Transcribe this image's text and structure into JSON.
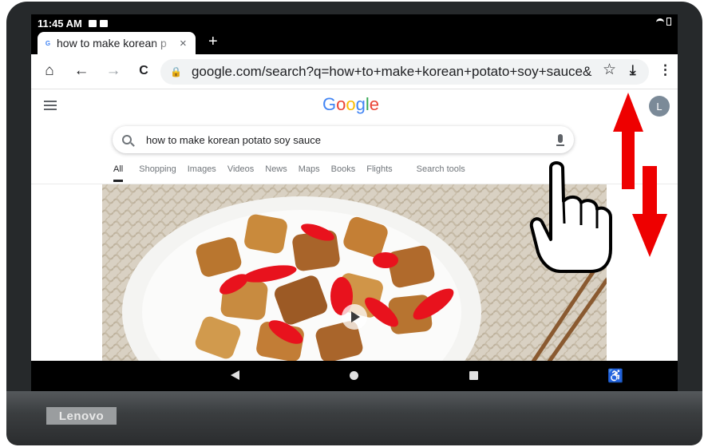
{
  "device": {
    "brand": "Lenovo"
  },
  "status_bar": {
    "time": "11:45 AM"
  },
  "tab": {
    "title": "how to make korean p",
    "close": "×",
    "new_tab": "+"
  },
  "toolbar": {
    "home": "⌂",
    "back": "←",
    "forward": "→",
    "reload": "C",
    "url": "google.com/search?q=how+to+make+korean+potato+soy+sauce&",
    "star": "☆",
    "download": "⤓",
    "menu": "⋮"
  },
  "google": {
    "logo_letters": [
      {
        "ch": "G",
        "color": "#4285F4"
      },
      {
        "ch": "o",
        "color": "#EA4335"
      },
      {
        "ch": "o",
        "color": "#FBBC05"
      },
      {
        "ch": "g",
        "color": "#4285F4"
      },
      {
        "ch": "l",
        "color": "#34A853"
      },
      {
        "ch": "e",
        "color": "#EA4335"
      }
    ],
    "avatar_letter": "L",
    "query": "how to make korean potato soy sauce",
    "nav_tabs": [
      "All",
      "Shopping",
      "Images",
      "Videos",
      "News",
      "Maps",
      "Books",
      "Flights"
    ],
    "search_tools": "Search tools"
  },
  "gesture": {
    "arrow_color": "#ee0000",
    "directions": [
      "up",
      "down"
    ]
  }
}
